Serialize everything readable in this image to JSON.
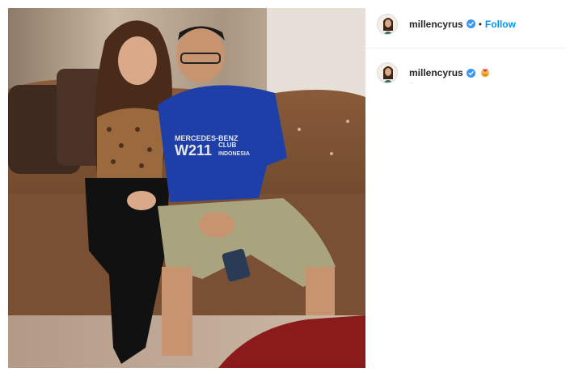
{
  "post": {
    "author": {
      "username": "millencyrus",
      "verified": true,
      "avatar_icon": "profile-avatar"
    },
    "header": {
      "separator": "•",
      "follow_label": "Follow"
    },
    "caption": {
      "username": "millencyrus",
      "verified": true,
      "emoji_icon": "heart-face-emoji-icon",
      "meta_text": "··"
    },
    "photo": {
      "shirt_text_line1": "MERCEDES-BENZ",
      "shirt_text_line2": "W211",
      "shirt_text_line3": "CLUB",
      "shirt_text_line4": "INDONESIA"
    }
  },
  "colors": {
    "accent": "#0095f6",
    "verified": "#3897f0",
    "text": "#262626",
    "divider": "#efefef"
  }
}
